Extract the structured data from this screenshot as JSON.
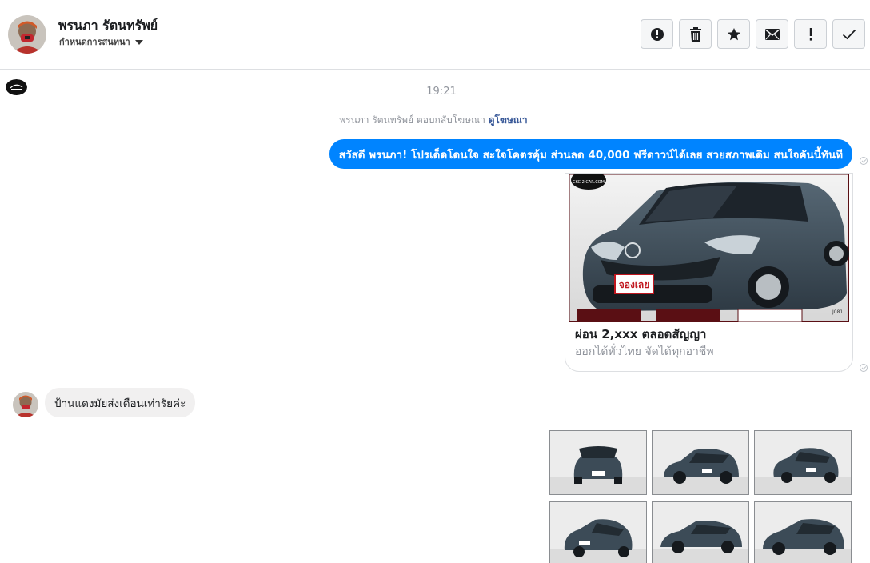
{
  "header": {
    "contact_name": "พรนภา รัตนทรัพย์",
    "settings_label": "กำหนดการสนทนา",
    "toolbar": [
      {
        "name": "report-spam-button",
        "icon": "alert-circle-icon"
      },
      {
        "name": "delete-button",
        "icon": "trash-icon"
      },
      {
        "name": "star-button",
        "icon": "star-icon"
      },
      {
        "name": "mark-unread-button",
        "icon": "envelope-icon"
      },
      {
        "name": "follow-up-button",
        "icon": "exclamation-icon"
      },
      {
        "name": "mark-done-button",
        "icon": "checkmark-icon"
      }
    ]
  },
  "conversation": {
    "timestamp": "19:21",
    "ad_reply_prefix": "พรนภา รัตนทรัพย์ ตอบกลับโฆษณา",
    "ad_reply_link": "ดูโฆษณา",
    "outgoing_message": "สวัสดี พรนภา! โปรเด็ดโดนใจ สะใจโคตรคุ้ม ส่วนลด 40,000 ฟรีดาวน์ได้เลย สวยสภาพเดิม สนใจคันนี้ทันที",
    "ad_card": {
      "title": "ผ่อน 2,xxx ตลอดสัญญา",
      "subtitle": "ออกได้ทั่วไทย จัดได้ทุกอาชีพ",
      "image_badge": "จองเลย",
      "image_logo": "CKC 2 CAR.COM",
      "image_code": "J081"
    },
    "incoming_message": "ป้านแดงมัยส่งเดือนเท่ารัยค่ะ",
    "thumbnails_count_visible": 6
  },
  "colors": {
    "messenger_blue": "#0084ff",
    "incoming_bubble": "#f1f0f0",
    "link": "#385898",
    "muted_text": "#90949c",
    "car_paint": "#3c4b57"
  }
}
